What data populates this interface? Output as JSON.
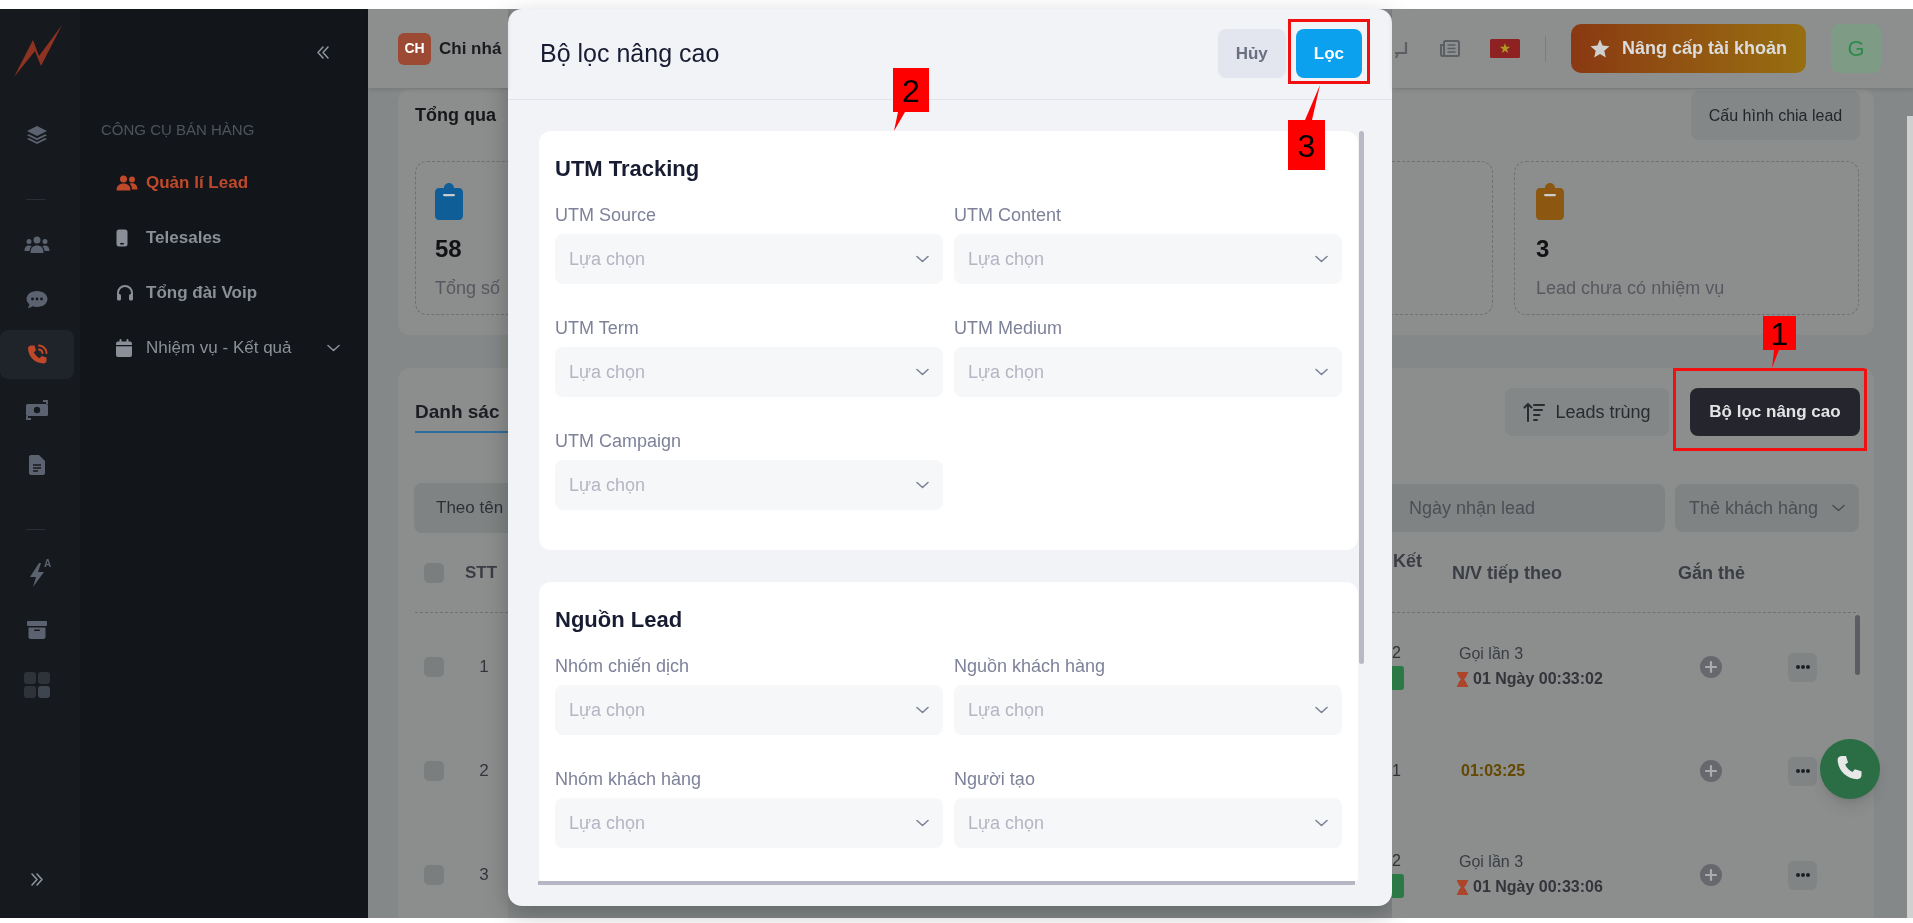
{
  "sidebar": {
    "rail_groups": [
      [
        {
          "selected": false
        }
      ],
      [
        {
          "selected": false
        },
        {
          "selected": false
        },
        {
          "selected": true
        },
        {
          "selected": false
        },
        {
          "selected": false
        }
      ],
      [
        {
          "selected": false,
          "badge": "A"
        },
        {
          "selected": false
        },
        {
          "selected": false
        }
      ]
    ],
    "section_title": "CÔNG CỤ BÁN HÀNG",
    "items": [
      {
        "label": "Quản lí Lead",
        "kind": "link",
        "selected": true
      },
      {
        "label": "Telesales",
        "kind": "link",
        "selected": false
      },
      {
        "label": "Tổng đài Voip",
        "kind": "link",
        "selected": false
      },
      {
        "label": "Nhiệm vụ - Kết quả",
        "kind": "group",
        "selected": false,
        "expanded": false
      }
    ]
  },
  "header": {
    "branch_badge": "CH",
    "branch_name": "Chi nhá",
    "upgrade_button": "Nâng cấp tài khoản",
    "avatar": "G"
  },
  "overview": {
    "title": "Tổng qua",
    "config_button": "Cấu hình chia lead",
    "stats": [
      {
        "value": "58",
        "label": "Tổng số",
        "color": "#0f5e98"
      },
      {
        "value": "3",
        "label": "Lead chưa có nhiệm vụ",
        "color": "#8c5710"
      }
    ]
  },
  "lead_list": {
    "tab": {
      "label": "Danh sác",
      "selected": true
    },
    "buttons": [
      {
        "label": "Leads trùng",
        "kind": "secondary",
        "highlighted": false
      },
      {
        "label": "Bộ lọc nâng cao",
        "kind": "primary",
        "highlighted": true
      }
    ],
    "filters": [
      {
        "placeholder": "Theo tên"
      },
      {
        "placeholder": "Ngày nhận lead"
      },
      {
        "placeholder": "Thẻ khách hàng"
      }
    ],
    "header_checked": false,
    "columns": [
      {
        "label": "STT"
      },
      {
        "label": "Kết"
      },
      {
        "label": "N/V tiếp theo"
      },
      {
        "label": "Gắn thẻ"
      }
    ],
    "rows": [
      {
        "checked": false,
        "stt": "1",
        "column_2": {
          "text": "2",
          "badge": true
        },
        "next_task": {
          "kind": "countdown",
          "title": "Gọi lần 3",
          "time": "01 Ngày 00:33:02"
        }
      },
      {
        "checked": false,
        "stt": "2",
        "column_2": {
          "text": "1",
          "badge": false
        },
        "next_task": {
          "kind": "timer",
          "time": "01:03:25"
        }
      },
      {
        "checked": false,
        "stt": "3",
        "column_2": {
          "text": "2",
          "badge": true
        },
        "next_task": {
          "kind": "countdown",
          "title": "Gọi lần 3",
          "time": "01 Ngày 00:33:06"
        }
      }
    ]
  },
  "filter_modal": {
    "title": "Bộ lọc nâng cao",
    "buttons": [
      {
        "label": "Hủy",
        "kind": "secondary",
        "highlighted": false
      },
      {
        "label": "Lọc",
        "kind": "primary",
        "highlighted": true
      }
    ],
    "sections": [
      {
        "title": "UTM Tracking",
        "fields": [
          {
            "label": "UTM Source",
            "placeholder": "Lựa chọn"
          },
          {
            "label": "UTM Content",
            "placeholder": "Lựa chọn"
          },
          {
            "label": "UTM Term",
            "placeholder": "Lựa chọn"
          },
          {
            "label": "UTM Medium",
            "placeholder": "Lựa chọn"
          },
          {
            "label": "UTM Campaign",
            "placeholder": "Lựa chọn"
          }
        ]
      },
      {
        "title": "Nguồn Lead",
        "fields": [
          {
            "label": "Nhóm chiến dịch",
            "placeholder": "Lựa chọn"
          },
          {
            "label": "Nguồn khách hàng",
            "placeholder": "Lựa chọn"
          },
          {
            "label": "Nhóm khách hàng",
            "placeholder": "Lựa chọn"
          },
          {
            "label": "Người tạo",
            "placeholder": "Lựa chọn"
          }
        ]
      }
    ]
  },
  "annotations": [
    {
      "label": "1"
    },
    {
      "label": "2"
    },
    {
      "label": "3"
    }
  ]
}
